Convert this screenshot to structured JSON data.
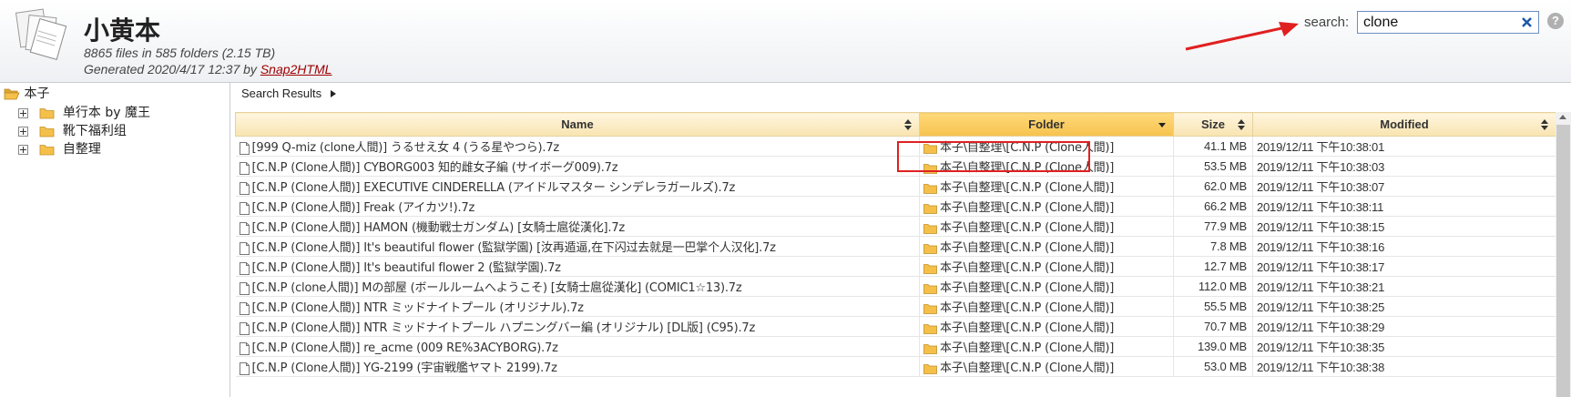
{
  "header": {
    "title": "小黄本",
    "stats": "8865 files in 585 folders (2.15 TB)",
    "generated_prefix": "Generated 2020/4/17 12:37 by ",
    "generator_link": "Snap2HTML"
  },
  "search": {
    "label": "search:",
    "value": "clone",
    "help": "?"
  },
  "tree": {
    "root": "本子",
    "children": [
      "单行本 by 魔王",
      "靴下福利组",
      "自整理"
    ]
  },
  "results": {
    "title": "Search Results",
    "columns": [
      "Name",
      "Folder",
      "Size",
      "Modified"
    ],
    "sorted_column": "Folder",
    "rows": [
      {
        "name": "[999 Q-miz (clone人間)] うるせえ女 4 (うる星やつら).7z",
        "folder": "本子\\自整理\\[C.N.P (Clone人間)]",
        "size": "41.1 MB",
        "modified": "2019/12/11 下午10:38:01"
      },
      {
        "name": "[C.N.P (Clone人間)] CYBORG003 知的雌女子編 (サイボーグ009).7z",
        "folder": "本子\\自整理\\[C.N.P (Clone人間)]",
        "size": "53.5 MB",
        "modified": "2019/12/11 下午10:38:03"
      },
      {
        "name": "[C.N.P (Clone人間)] EXECUTIVE CINDERELLA (アイドルマスター シンデレラガールズ).7z",
        "folder": "本子\\自整理\\[C.N.P (Clone人間)]",
        "size": "62.0 MB",
        "modified": "2019/12/11 下午10:38:07"
      },
      {
        "name": "[C.N.P (Clone人間)] Freak (アイカツ!).7z",
        "folder": "本子\\自整理\\[C.N.P (Clone人間)]",
        "size": "66.2 MB",
        "modified": "2019/12/11 下午10:38:11"
      },
      {
        "name": "[C.N.P (Clone人間)] HAMON (機動戦士ガンダム) [女騎士扈從漢化].7z",
        "folder": "本子\\自整理\\[C.N.P (Clone人間)]",
        "size": "77.9 MB",
        "modified": "2019/12/11 下午10:38:15"
      },
      {
        "name": "[C.N.P (Clone人間)] It's beautiful flower (監獄学園) [汝再遁逼,在下闪过去就是一巴掌个人汉化].7z",
        "folder": "本子\\自整理\\[C.N.P (Clone人間)]",
        "size": "7.8 MB",
        "modified": "2019/12/11 下午10:38:16"
      },
      {
        "name": "[C.N.P (Clone人間)] It's beautiful flower 2 (監獄学園).7z",
        "folder": "本子\\自整理\\[C.N.P (Clone人間)]",
        "size": "12.7 MB",
        "modified": "2019/12/11 下午10:38:17"
      },
      {
        "name": "[C.N.P (clone人間)] Mの部屋 (ボールルームへようこそ) [女騎士扈從漢化] (COMIC1☆13).7z",
        "folder": "本子\\自整理\\[C.N.P (Clone人間)]",
        "size": "112.0 MB",
        "modified": "2019/12/11 下午10:38:21"
      },
      {
        "name": "[C.N.P (Clone人間)] NTR ミッドナイトプール (オリジナル).7z",
        "folder": "本子\\自整理\\[C.N.P (Clone人間)]",
        "size": "55.5 MB",
        "modified": "2019/12/11 下午10:38:25"
      },
      {
        "name": "[C.N.P (Clone人間)] NTR ミッドナイトプール ハプニングバー編 (オリジナル) [DL版] (C95).7z",
        "folder": "本子\\自整理\\[C.N.P (Clone人間)]",
        "size": "70.7 MB",
        "modified": "2019/12/11 下午10:38:29"
      },
      {
        "name": "[C.N.P (Clone人間)] re_acme (009 RE%3ACYBORG).7z",
        "folder": "本子\\自整理\\[C.N.P (Clone人間)]",
        "size": "139.0 MB",
        "modified": "2019/12/11 下午10:38:35"
      },
      {
        "name": "[C.N.P (Clone人間)] YG-2199 (宇宙戦艦ヤマト 2199).7z",
        "folder": "本子\\自整理\\[C.N.P (Clone人間)]",
        "size": "53.0 MB",
        "modified": "2019/12/11 下午10:38:38"
      }
    ]
  },
  "colors": {
    "header_bg": "#eef0f3",
    "column_header_bg": "#f8e4b0",
    "sorted_header_bg": "#f5c24e",
    "link": "#a00000",
    "annotation": "#e02020",
    "folder_icon": "#f5c04a"
  },
  "icons": {
    "logo": "documents-icon",
    "clear": "close-icon",
    "help": "help-icon",
    "folder": "folder-icon",
    "open_folder": "folder-open-icon",
    "file": "file-icon",
    "expander": "plus-icon",
    "results_arrow": "triangle-right-icon",
    "sort": "sort-icon"
  }
}
